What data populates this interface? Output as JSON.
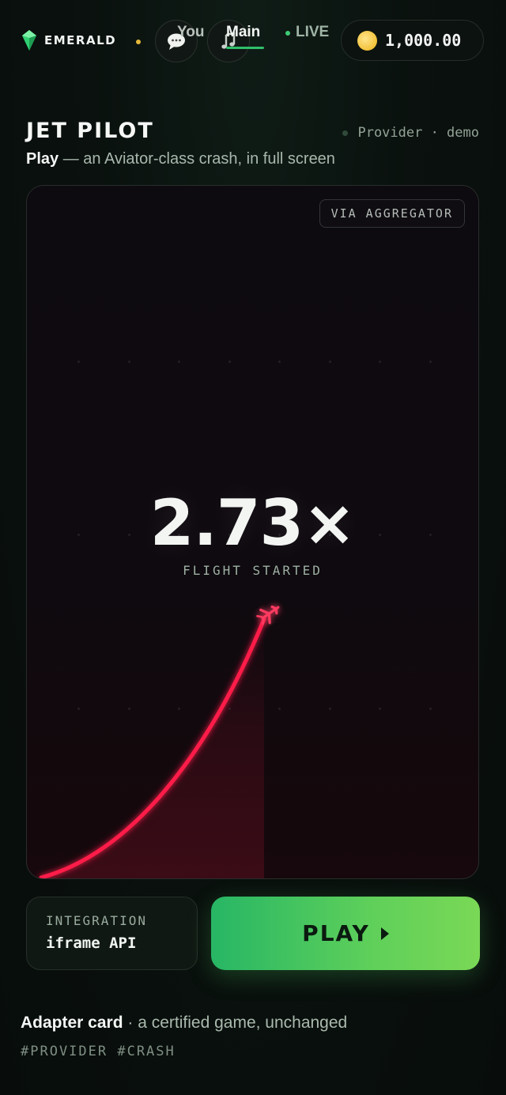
{
  "header": {
    "brand": "EMERALD",
    "nav": {
      "you": "You",
      "main": "Main",
      "live": "LIVE"
    },
    "balance": "1,000.00",
    "icons": [
      "emerald-logo-icon",
      "chat-icon",
      "music-icon",
      "coin-icon"
    ]
  },
  "game": {
    "title": "JET PILOT",
    "provider": "Provider · demo",
    "subtitle_strong": "Play",
    "subtitle_rest": " — an Aviator-class crash, in full screen",
    "badge": "VIA AGGREGATOR",
    "multiplier": "2.73×",
    "status": "FLIGHT STARTED",
    "curve_color": "#ff1e48",
    "plane_icon": "plane-icon"
  },
  "controls": {
    "integration_label": "INTEGRATION",
    "integration_value": "iframe API",
    "play_label": "PLAY",
    "accent": "#3fc463"
  },
  "footer": {
    "card_title_strong": "Adapter card",
    "card_title_rest": " · a certified game, unchanged",
    "tags": "#PROVIDER #CRASH"
  }
}
